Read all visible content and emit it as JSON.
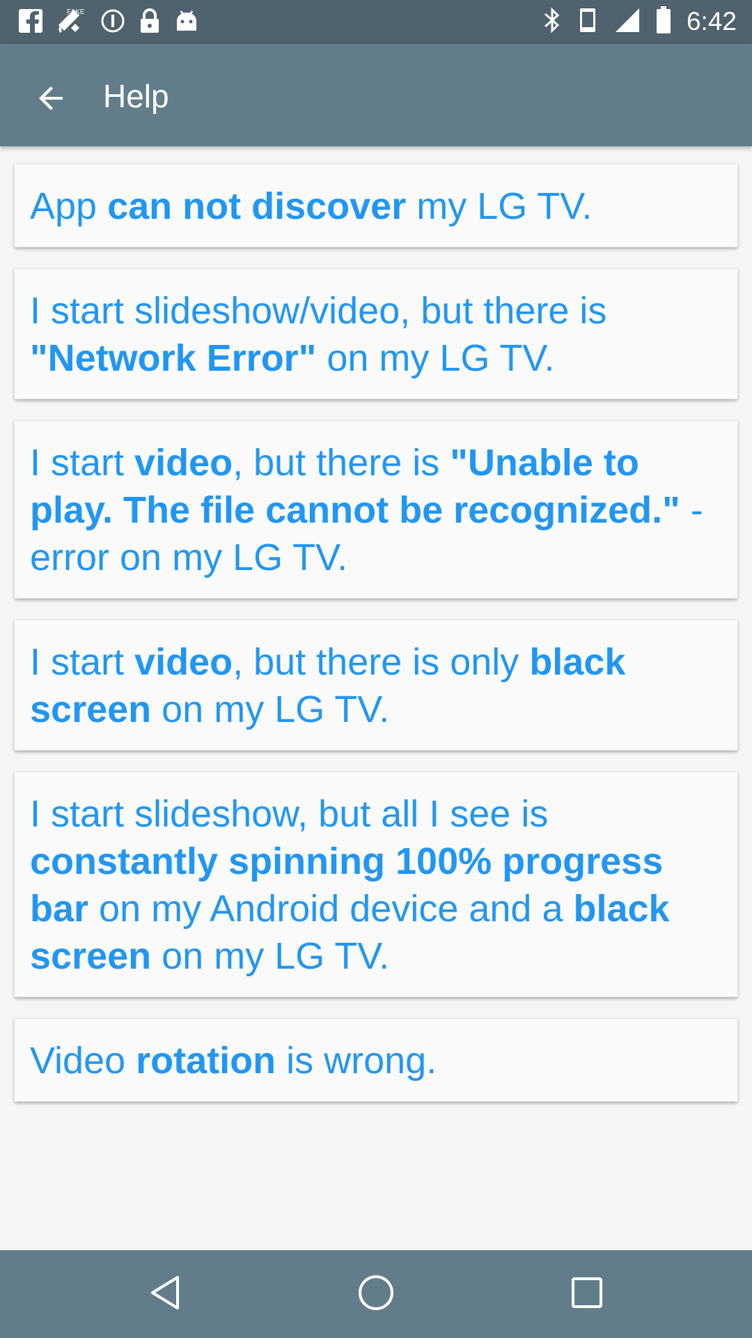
{
  "status_bar": {
    "time": "6:42",
    "left_icons": [
      "facebook-icon",
      "fake-gps-icon",
      "info-icon",
      "lock-icon",
      "android-icon"
    ],
    "right_icons": [
      "bluetooth-icon",
      "vibrate-icon",
      "signal-icon",
      "battery-icon"
    ]
  },
  "app_bar": {
    "title": "Help",
    "back_icon": "arrow-back-icon"
  },
  "help_items": [
    [
      {
        "text": "App ",
        "bold": false
      },
      {
        "text": "can not discover",
        "bold": true
      },
      {
        "text": " my LG TV.",
        "bold": false
      }
    ],
    [
      {
        "text": "I start slideshow/video, but there is ",
        "bold": false
      },
      {
        "text": "\"Network Error\"",
        "bold": true
      },
      {
        "text": " on my LG TV.",
        "bold": false
      }
    ],
    [
      {
        "text": "I start ",
        "bold": false
      },
      {
        "text": "video",
        "bold": true
      },
      {
        "text": ", but there is ",
        "bold": false
      },
      {
        "text": "\"Unable to play. The file cannot be recognized.\"",
        "bold": true
      },
      {
        "text": " - error on my LG TV.",
        "bold": false
      }
    ],
    [
      {
        "text": "I start ",
        "bold": false
      },
      {
        "text": "video",
        "bold": true
      },
      {
        "text": ", but there is only ",
        "bold": false
      },
      {
        "text": "black screen",
        "bold": true
      },
      {
        "text": " on my LG TV.",
        "bold": false
      }
    ],
    [
      {
        "text": "I start slideshow, but all I see is ",
        "bold": false
      },
      {
        "text": "constantly spinning 100% progress bar",
        "bold": true
      },
      {
        "text": " on my Android device and a ",
        "bold": false
      },
      {
        "text": "black screen",
        "bold": true
      },
      {
        "text": " on my LG TV.",
        "bold": false
      }
    ],
    [
      {
        "text": "Video ",
        "bold": false
      },
      {
        "text": "rotation",
        "bold": true
      },
      {
        "text": " is wrong.",
        "bold": false
      }
    ]
  ],
  "nav_bar": {
    "buttons": [
      "back-triangle-icon",
      "home-circle-icon",
      "recents-square-icon"
    ]
  },
  "colors": {
    "status_bar": "#4f626d",
    "app_bar": "#627d89",
    "accent_text": "#2196f3",
    "background": "#f5f5f5",
    "card": "#fafafa"
  }
}
